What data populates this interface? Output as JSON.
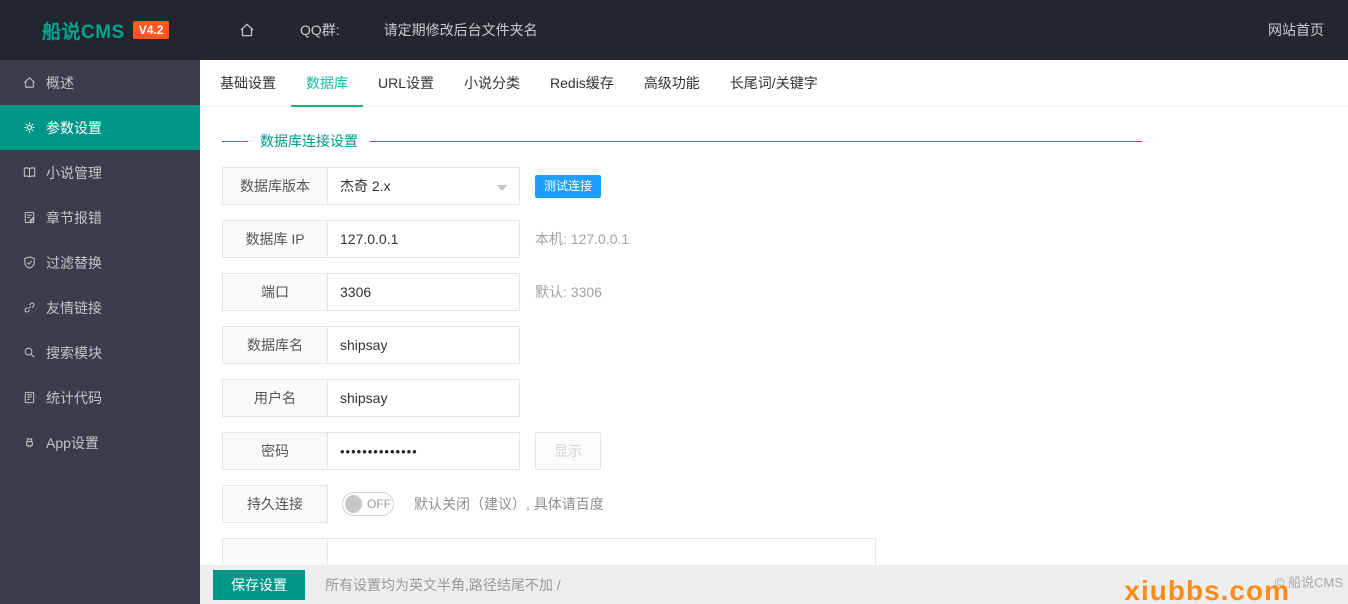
{
  "header": {
    "logo": "船说CMS",
    "version_badge": "V4.2",
    "qq_label": "QQ群:",
    "notice": "请定期修改后台文件夹名",
    "home_link": "网站首页"
  },
  "sidebar": {
    "items": [
      {
        "label": "概述",
        "icon": "home-icon",
        "active": false
      },
      {
        "label": "参数设置",
        "icon": "gear-icon",
        "active": true
      },
      {
        "label": "小说管理",
        "icon": "book-icon",
        "active": false
      },
      {
        "label": "章节报错",
        "icon": "report-icon",
        "active": false
      },
      {
        "label": "过滤替换",
        "icon": "shield-check-icon",
        "active": false
      },
      {
        "label": "友情链接",
        "icon": "link-icon",
        "active": false
      },
      {
        "label": "搜索模块",
        "icon": "search-icon",
        "active": false
      },
      {
        "label": "统计代码",
        "icon": "stats-code-icon",
        "active": false
      },
      {
        "label": "App设置",
        "icon": "android-icon",
        "active": false
      }
    ]
  },
  "tabs": [
    {
      "label": "基础设置",
      "active": false
    },
    {
      "label": "数据库",
      "active": true
    },
    {
      "label": "URL设置",
      "active": false
    },
    {
      "label": "小说分类",
      "active": false
    },
    {
      "label": "Redis缓存",
      "active": false
    },
    {
      "label": "高级功能",
      "active": false
    },
    {
      "label": "长尾词/关键字",
      "active": false
    }
  ],
  "section": {
    "title": "数据库连接设置"
  },
  "form": {
    "rows": [
      {
        "label": "数据库版本",
        "type": "select",
        "value": "杰奇 2.x",
        "action": "测试连接"
      },
      {
        "label": "数据库 IP",
        "type": "input",
        "value": "127.0.0.1",
        "hint": "本机: 127.0.0.1"
      },
      {
        "label": "端口",
        "type": "input",
        "value": "3306",
        "hint": "默认: 3306"
      },
      {
        "label": "数据库名",
        "type": "input",
        "value": "shipsay"
      },
      {
        "label": "用户名",
        "type": "input",
        "value": "shipsay"
      },
      {
        "label": "密码",
        "type": "password",
        "value": "••••••••••••••",
        "action": "显示"
      },
      {
        "label": "持久连接",
        "type": "toggle",
        "toggle_state": "OFF",
        "hint": "默认关闭（建议）, 具体请百度"
      },
      {
        "label": "",
        "type": "input-clipped",
        "value": ""
      }
    ]
  },
  "footer": {
    "save_label": "保存设置",
    "hint": "所有设置均为英文半角,路径结尾不加 /",
    "copyright": "© 船说CMS",
    "watermark": "xiubbs.com"
  },
  "colors": {
    "accent_teal": "#009688",
    "tab_active": "#16baaa",
    "header_bg": "#23262e",
    "sidebar_bg": "#393d49",
    "button_blue": "#1e9fff",
    "badge_orange": "#ff5722",
    "watermark_orange": "#ff8c1a"
  }
}
